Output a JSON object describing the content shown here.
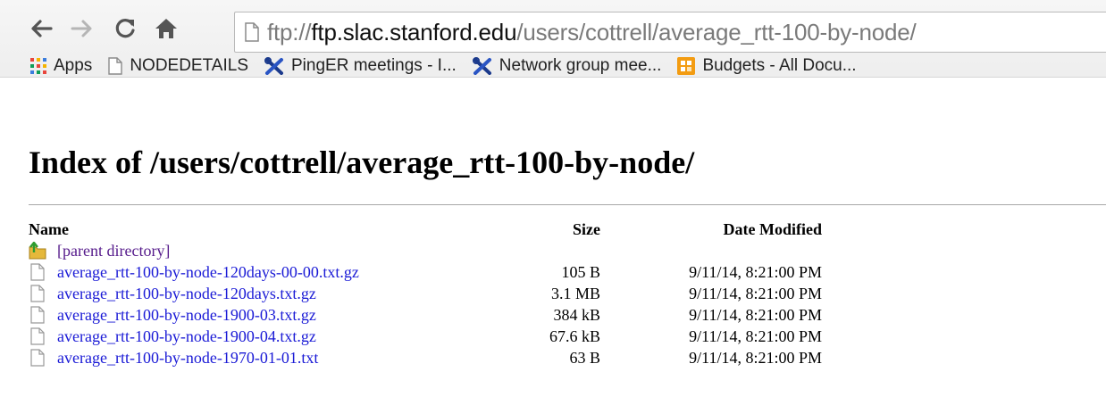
{
  "toolbar": {
    "url_scheme": "ftp://",
    "url_host": "ftp.slac.stanford.edu",
    "url_path": "/users/cottrell/average_rtt-100-by-node/",
    "back_icon": "back-arrow-icon",
    "forward_icon": "forward-arrow-icon",
    "reload_icon": "reload-icon",
    "home_icon": "home-icon"
  },
  "bookmarks": [
    {
      "label": "Apps",
      "icon": "apps-grid-icon"
    },
    {
      "label": "NODEDETAILS",
      "icon": "page-icon"
    },
    {
      "label": "PingER meetings - I...",
      "icon": "tools-icon"
    },
    {
      "label": "Network group mee...",
      "icon": "tools-icon"
    },
    {
      "label": "Budgets - All Docu...",
      "icon": "sharepoint-icon"
    }
  ],
  "page": {
    "title": "Index of /users/cottrell/average_rtt-100-by-node/",
    "columns": {
      "name": "Name",
      "size": "Size",
      "date": "Date Modified"
    },
    "parent_label": "[parent directory]",
    "files": [
      {
        "name": "average_rtt-100-by-node-120days-00-00.txt.gz",
        "size": "105 B",
        "date": "9/11/14, 8:21:00 PM"
      },
      {
        "name": "average_rtt-100-by-node-120days.txt.gz",
        "size": "3.1 MB",
        "date": "9/11/14, 8:21:00 PM"
      },
      {
        "name": "average_rtt-100-by-node-1900-03.txt.gz",
        "size": "384 kB",
        "date": "9/11/14, 8:21:00 PM"
      },
      {
        "name": "average_rtt-100-by-node-1900-04.txt.gz",
        "size": "67.6 kB",
        "date": "9/11/14, 8:21:00 PM"
      },
      {
        "name": "average_rtt-100-by-node-1970-01-01.txt",
        "size": "63 B",
        "date": "9/11/14, 8:21:00 PM"
      }
    ]
  },
  "colors": {
    "link": "#1a1ad6",
    "visited": "#551a8b"
  }
}
